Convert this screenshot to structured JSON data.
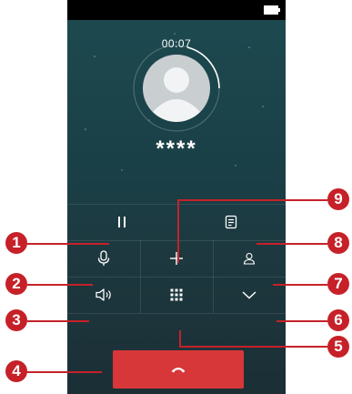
{
  "call": {
    "timer": "00:07",
    "caller": "****"
  },
  "controls": {
    "hold_icon": "pause-icon",
    "notes_icon": "notes-icon",
    "mute_icon": "microphone-icon",
    "add_call_icon": "plus-icon",
    "contacts_icon": "person-icon",
    "speaker_icon": "speaker-icon",
    "dialpad_icon": "dialpad-icon",
    "hide_icon": "chevron-down-icon",
    "end_call_icon": "phone-hangup-icon"
  },
  "callouts": [
    "1",
    "2",
    "3",
    "4",
    "5",
    "6",
    "7",
    "8",
    "9"
  ],
  "colors": {
    "end_call": "#d8373a",
    "callout": "#c62128",
    "screen_top": "#1d4a50",
    "screen_bottom": "#1b2f35"
  }
}
